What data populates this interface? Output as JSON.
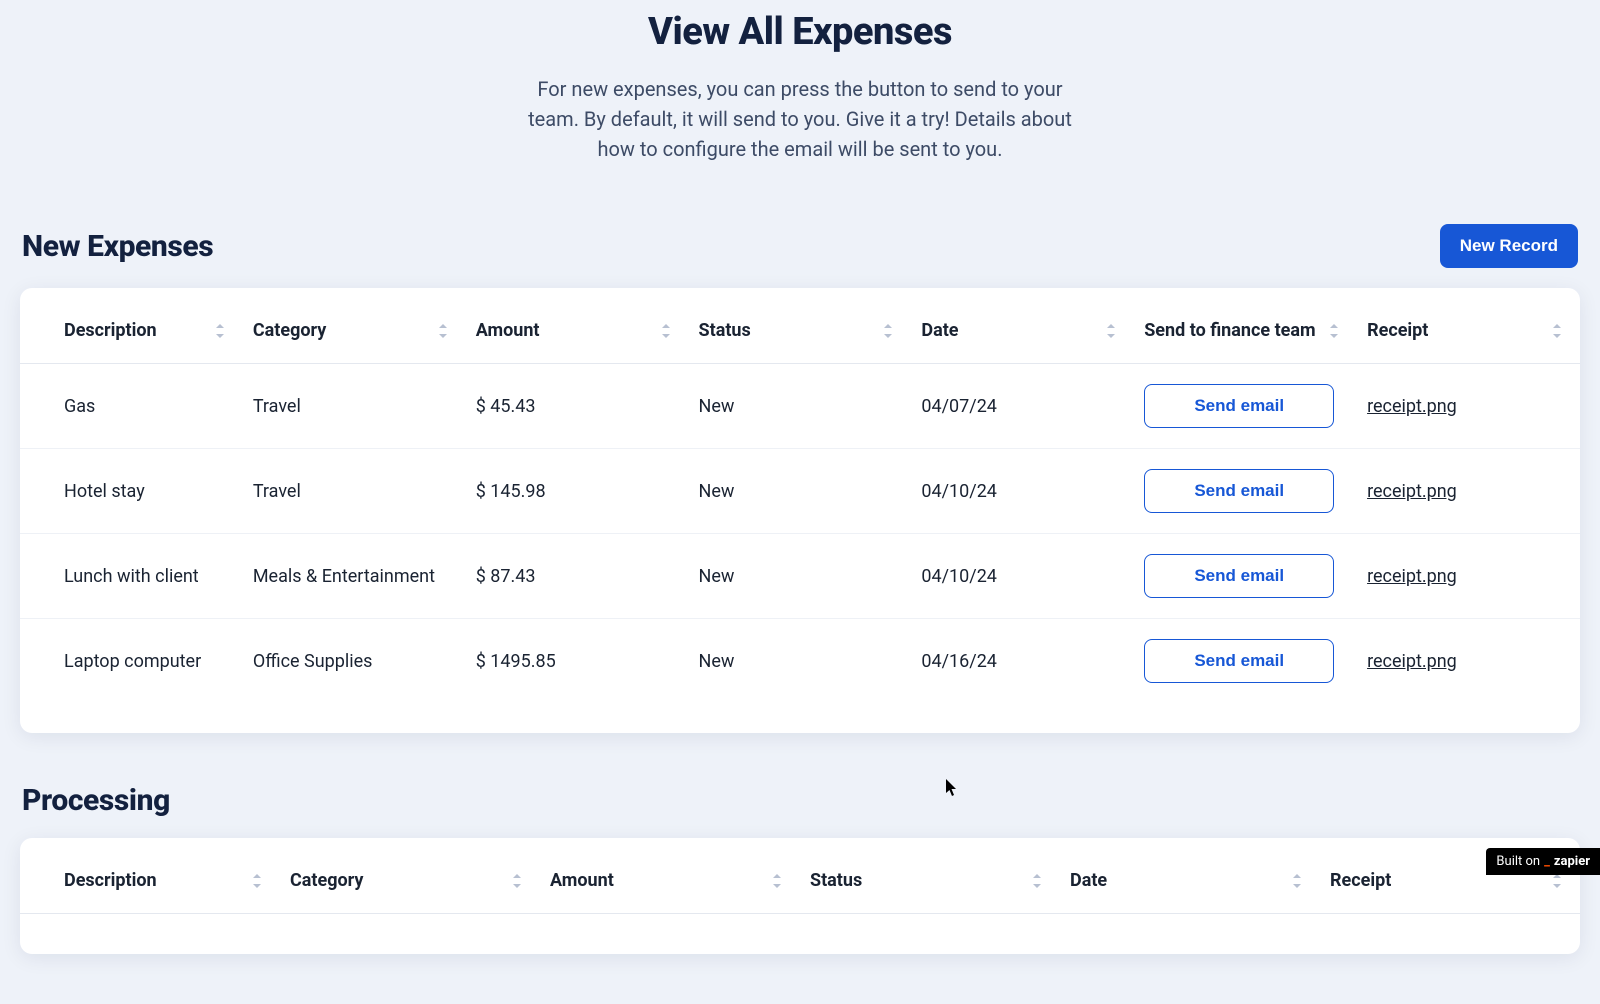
{
  "header": {
    "title": "View All Expenses",
    "subtitle": "For new expenses, you can press the button to send to your team. By default, it will send to you. Give it a try! Details about how to configure the email will be sent to you."
  },
  "sections": {
    "new_expenses": {
      "title": "New Expenses",
      "new_record_label": "New Record",
      "columns": {
        "description": "Description",
        "category": "Category",
        "amount": "Amount",
        "status": "Status",
        "date": "Date",
        "send": "Send to finance team",
        "receipt": "Receipt"
      },
      "send_button_label": "Send email",
      "rows": [
        {
          "description": "Gas",
          "category": "Travel",
          "amount": "$ 45.43",
          "status": "New",
          "date": "04/07/24",
          "receipt": "receipt.png"
        },
        {
          "description": "Hotel stay",
          "category": "Travel",
          "amount": "$ 145.98",
          "status": "New",
          "date": "04/10/24",
          "receipt": "receipt.png"
        },
        {
          "description": "Lunch with client",
          "category": "Meals & Entertainment",
          "amount": "$ 87.43",
          "status": "New",
          "date": "04/10/24",
          "receipt": "receipt.png"
        },
        {
          "description": "Laptop computer",
          "category": "Office Supplies",
          "amount": "$ 1495.85",
          "status": "New",
          "date": "04/16/24",
          "receipt": "receipt.png"
        }
      ]
    },
    "processing": {
      "title": "Processing",
      "columns": {
        "description": "Description",
        "category": "Category",
        "amount": "Amount",
        "status": "Status",
        "date": "Date",
        "receipt": "Receipt"
      }
    }
  },
  "badge": {
    "prefix": "Built on ",
    "brand": "zapier"
  }
}
